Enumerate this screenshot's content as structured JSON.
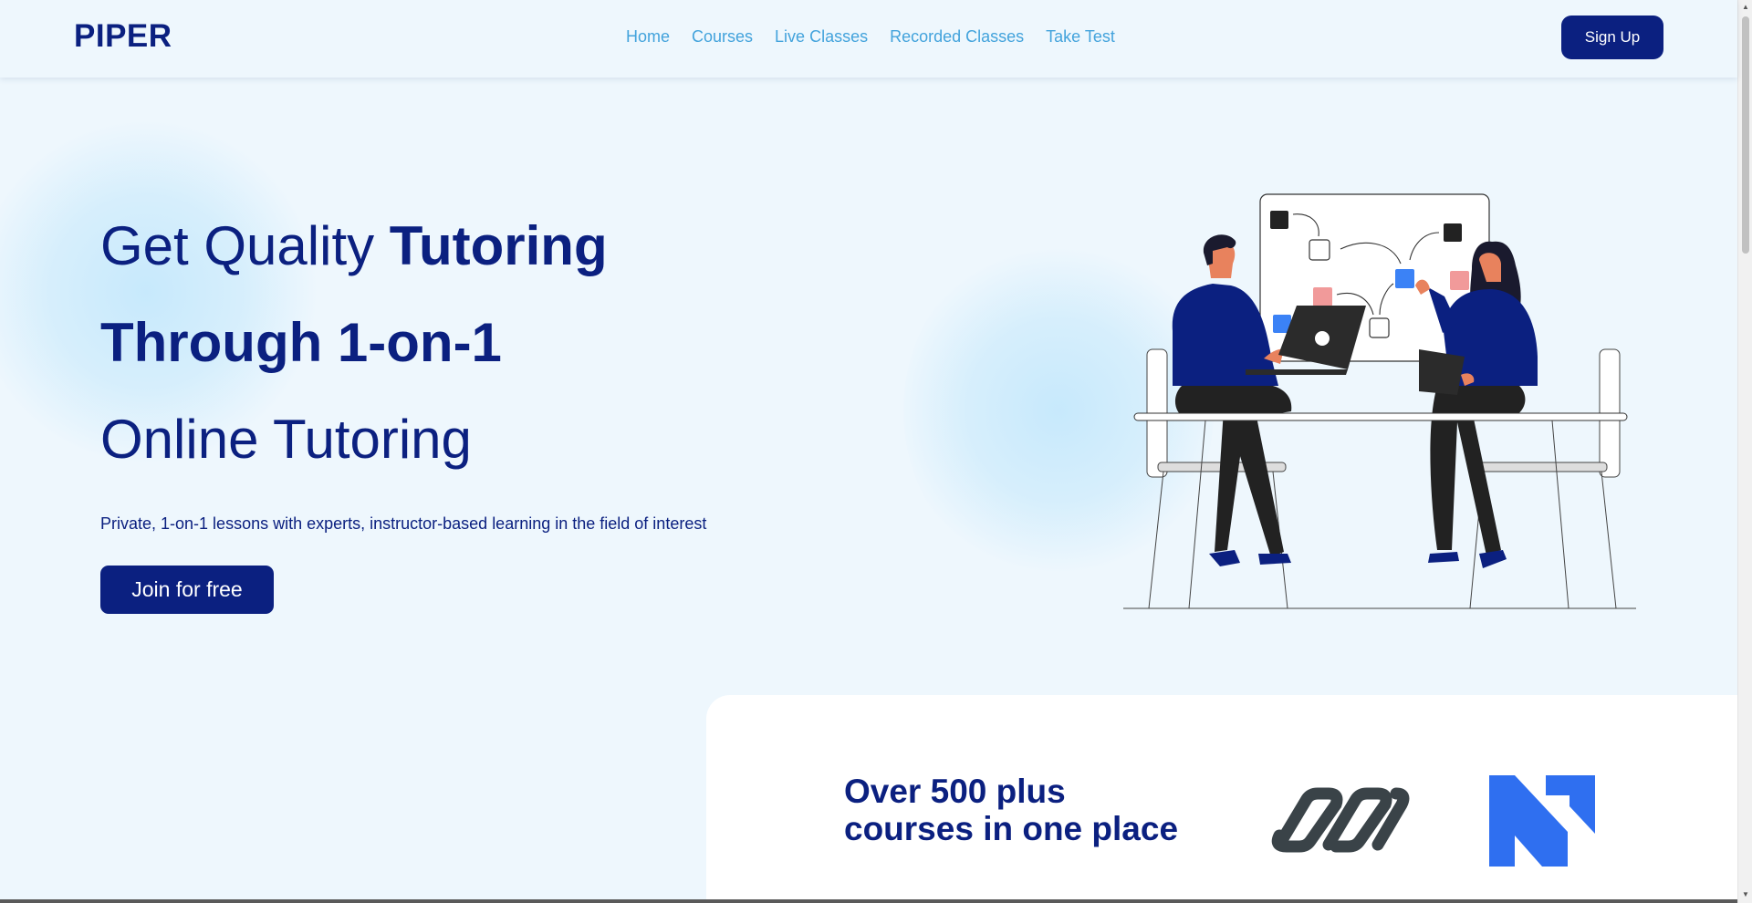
{
  "header": {
    "logo": "PIPER",
    "nav": [
      {
        "label": "Home"
      },
      {
        "label": "Courses"
      },
      {
        "label": "Live Classes"
      },
      {
        "label": "Recorded Classes"
      },
      {
        "label": "Take Test"
      }
    ],
    "signup_label": "Sign Up"
  },
  "hero": {
    "line1_regular": "Get Quality ",
    "line1_bold": "Tutoring",
    "line2": "Through 1-on-1",
    "line3": "Online Tutoring",
    "subtitle": "Private, 1-on-1 lessons with experts, instructor-based learning in the field of interest",
    "cta_label": "Join for free"
  },
  "card": {
    "title_line1": "Over 500 plus",
    "title_line2": "courses in one place",
    "partner_logos": [
      "chain-link-logo",
      "n-logo"
    ]
  },
  "colors": {
    "brand_navy": "#0b2080",
    "nav_link": "#43a3dc",
    "background": "#eef7fd",
    "accent_blue": "#3b82f6",
    "accent_pink": "#f19a9a",
    "partner_gray": "#3a4348",
    "partner_blue": "#2f6ff0"
  }
}
